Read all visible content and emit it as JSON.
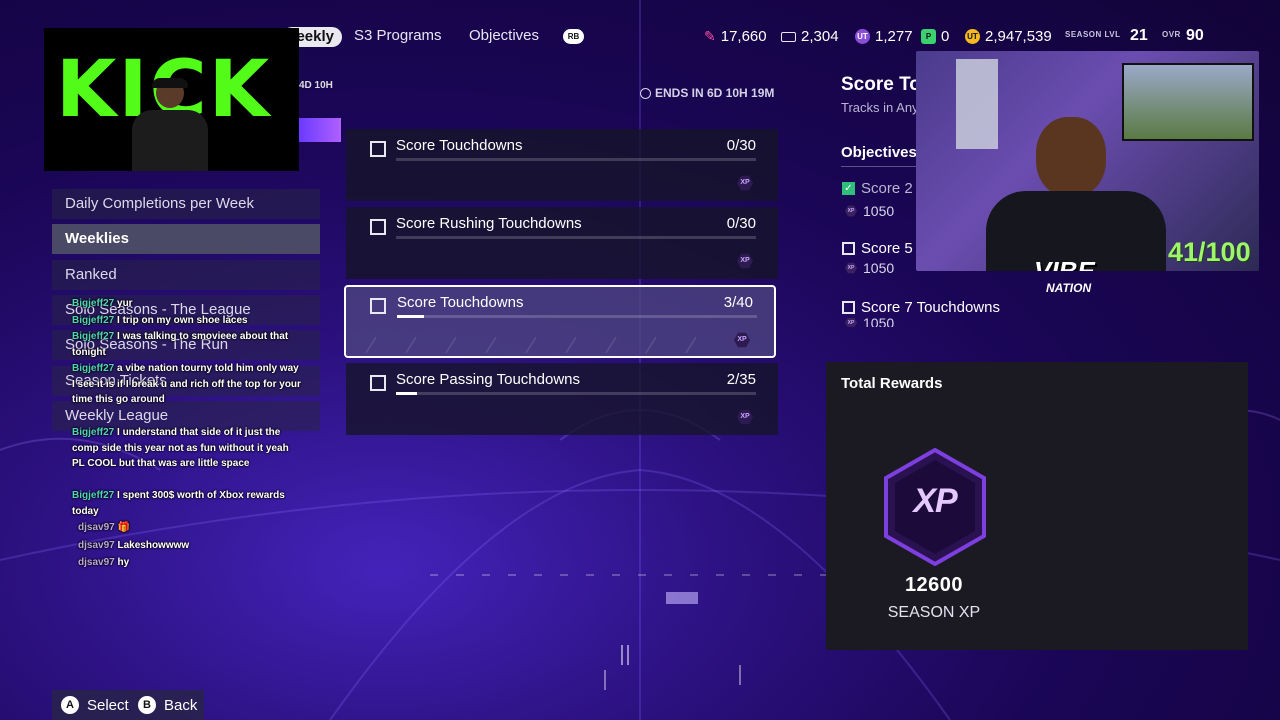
{
  "nav": {
    "active_tab": "Weekly",
    "tabs": [
      "S3 Programs",
      "Objectives"
    ],
    "rb_label": "RB"
  },
  "currencies": [
    {
      "icon": "training-icon",
      "value": "17,660",
      "color": "#ff4fa3"
    },
    {
      "icon": "card-icon",
      "value": "2,304",
      "color": "#e8e6f5"
    },
    {
      "icon": "ut-token-icon",
      "value": "1,277",
      "color": "#8a4dd6",
      "label": "UT"
    },
    {
      "icon": "p-icon",
      "value": "0",
      "color": "#3bd16f",
      "label": "P"
    },
    {
      "icon": "ut-coin-icon",
      "value": "2,947,539",
      "color": "#f5b921",
      "label": "UT"
    }
  ],
  "season": {
    "lvl_label": "SEASON LVL",
    "lvl": "21",
    "ovr_label": "OVR",
    "ovr": "90"
  },
  "stream": {
    "kick_text": "KICK",
    "timer_partial": "4D 10H",
    "cam_counter": "41/100",
    "cam_brand": "VIBE",
    "cam_brand_sub": "NATION"
  },
  "ends_in": "ENDS IN 6D 10H 19M",
  "menu": [
    {
      "label": "Daily Completions per Week",
      "selected": false
    },
    {
      "label": "Weeklies",
      "selected": true
    },
    {
      "label": "Ranked",
      "selected": false
    },
    {
      "label": "Solo Seasons - The League",
      "selected": false
    },
    {
      "label": "Solo Seasons - The Run",
      "selected": false
    },
    {
      "label": "Season Tickets",
      "selected": false
    },
    {
      "label": "Weekly League",
      "selected": false
    }
  ],
  "chat": [
    {
      "user": "Bigjeff27",
      "text": "yur"
    },
    {
      "user": "Bigjeff27",
      "text": "I trip on my own shoe laces"
    },
    {
      "user": "Bigjeff27",
      "text": "I was talking to smovieee about that tonight"
    },
    {
      "user": "Bigjeff27",
      "text": "a vibe nation tourny told him only way I see it is if I break u and rich off the top for your time this go around"
    },
    {
      "user": "Bigjeff27",
      "text": "I understand that side of it just the comp side this year not as fun without it yeah PL COOL but that was are little space"
    },
    {
      "user": "Bigjeff27",
      "text": "I spent 300$ worth of Xbox rewards today"
    },
    {
      "user": "djsav97",
      "text": "🎁"
    },
    {
      "user": "djsav97",
      "text": "Lakeshowwww"
    },
    {
      "user": "djsav97",
      "text": "hy"
    }
  ],
  "objectives": [
    {
      "title": "Score Touchdowns",
      "progress": "0/30",
      "fraction": 0.0,
      "selected": false
    },
    {
      "title": "Score Rushing Touchdowns",
      "progress": "0/30",
      "fraction": 0.0,
      "selected": false
    },
    {
      "title": "Score Touchdowns",
      "progress": "3/40",
      "fraction": 0.075,
      "selected": true
    },
    {
      "title": "Score Passing Touchdowns",
      "progress": "2/35",
      "fraction": 0.057,
      "selected": false
    }
  ],
  "xp_badge_text": "XP",
  "detail": {
    "title": "Score To",
    "subtitle": "Tracks in Any",
    "objectives_header": "Objectives",
    "items": [
      {
        "label": "Score 2",
        "xp": "1050",
        "done": true
      },
      {
        "label": "Score 5",
        "xp": "1050",
        "done": false
      },
      {
        "label": "Score 7 Touchdowns",
        "xp": "1050",
        "done": false
      }
    ]
  },
  "rewards": {
    "title": "Total Rewards",
    "amount": "12600",
    "type": "SEASON XP",
    "badge": "XP"
  },
  "controls": [
    {
      "button": "A",
      "label": "Select"
    },
    {
      "button": "B",
      "label": "Back"
    }
  ]
}
